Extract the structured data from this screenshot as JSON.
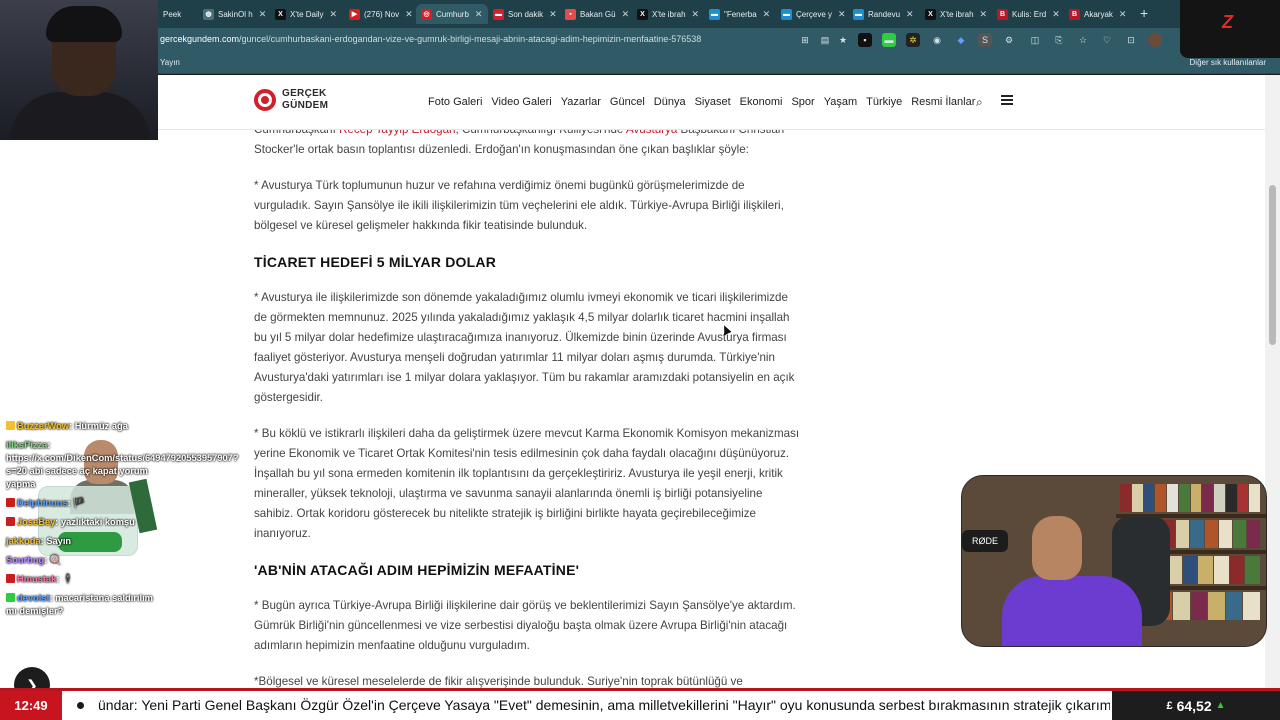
{
  "browser": {
    "tabs": [
      {
        "label": "Peek",
        "fav_color": "#2f5a66"
      },
      {
        "label": "SakinOl h",
        "fav_color": "#4a6f79"
      },
      {
        "label": "X'te Daily",
        "fav_color": "#111111"
      },
      {
        "label": "(276) Nov",
        "fav_color": "#d62020"
      },
      {
        "label": "Cumhurb",
        "fav_color": "#d11f2c"
      },
      {
        "label": "Son dakik",
        "fav_color": "#d11f2c"
      },
      {
        "label": "Bakan Gü",
        "fav_color": "#e44b4b"
      },
      {
        "label": "X'te ibrah",
        "fav_color": "#111111"
      },
      {
        "label": "\"Fenerba",
        "fav_color": "#1d8fd1"
      },
      {
        "label": "Çerçeve y",
        "fav_color": "#1d8fd1"
      },
      {
        "label": "Randevu",
        "fav_color": "#1d8fd1"
      },
      {
        "label": "X'te ibrah",
        "fav_color": "#111111"
      },
      {
        "label": "Kulis: Erd",
        "fav_color": "#b5182a"
      },
      {
        "label": "Akaryak",
        "fav_color": "#b5182a"
      }
    ],
    "new_tab_label": "+",
    "url_host": "gercekgundem.com",
    "url_path": "/guncel/cumhurbaskani-erdogandan-vize-ve-gumruk-birligi-mesaji-abnin-atacagi-adim-hepimizin-menfaatine-576538",
    "bookmark_yayin": "Yayın",
    "bookmark_other": "Diğer sık kullanılanlar"
  },
  "site": {
    "logo_line1": "GERÇEK",
    "logo_line2": "GÜNDEM",
    "brand_color": "#d11f2c",
    "nav": [
      "Foto Galeri",
      "Video Galeri",
      "Yazarlar",
      "Güncel",
      "Dünya",
      "Siyaset",
      "Ekonomi",
      "Spor",
      "Yaşam",
      "Türkiye",
      "Resmi İlanlar"
    ]
  },
  "article": {
    "p0_pre": "Cumhurbaşkanı ",
    "p0_link1": "Recep Tayyip Erdoğan",
    "p0_mid": ", Cumhurbaşkanlığı Külliyesi'nde ",
    "p0_link2": "Avusturya",
    "p0_post": " Başbakanı Christian Stocker'le ortak basın toplantısı düzenledi. Erdoğan'ın konuşmasından öne çıkan başlıklar şöyle:",
    "p1": "* Avusturya Türk toplumunun huzur ve refahına verdiğimiz önemi bugünkü görüşmelerimizde de vurguladık. Sayın Şansölye ile ikili ilişkilerimizin tüm veçhelerini ele aldık. Türkiye-Avrupa Birliği ilişkileri, bölgesel ve küresel gelişmeler hakkında fikir teatisinde bulunduk.",
    "h1": "TİCARET HEDEFİ 5 MİLYAR DOLAR",
    "p2": "* Avusturya ile ilişkilerimizde son dönemde yakaladığımız olumlu ivmeyi ekonomik ve ticari ilişkilerimizde de görmekten memnunuz. 2025 yılında yakaladığımız yaklaşık 4,5 milyar dolarlık ticaret hacmini inşallah bu yıl 5 milyar dolar hedefimize ulaştıracağımıza inanıyoruz. Ülkemizde binin üzerinde Avusturya firması faaliyet gösteriyor. Avusturya menşeli doğrudan yatırımlar 11 milyar doları aşmış durumda. Türkiye'nin Avusturya'daki yatırımları ise 1 milyar dolara yaklaşıyor. Tüm bu rakamlar aramızdaki potansiyelin en açık göstergesidir.",
    "p3": "* Bu köklü ve istikrarlı ilişkileri daha da geliştirmek üzere mevcut Karma Ekonomik Komisyon mekanizması yerine Ekonomik ve Ticaret Ortak Komitesi'nin tesis edilmesinin çok daha faydalı olacağını düşünüyoruz. İnşallah bu yıl sona ermeden komitenin ilk toplantısını da gerçekleştiririz. Avusturya ile yeşil enerji, kritik mineraller, yüksek teknoloji, ulaştırma ve savunma sanayii alanlarında önemli iş birliği potansiyeline sahibiz. Ortak koridoru gösterecek bu nitelikte stratejik iş birliğini birlikte hayata geçirebileceğimize inanıyoruz.",
    "h2": "'AB'NİN ATACAĞI ADIM HEPİMİZİN MEFAATİNE'",
    "p4": "* Bugün ayrıca Türkiye-Avrupa Birliği ilişkilerine dair görüş ve beklentilerimizi Sayın Şansölye'ye aktardım. Gümrük Birliği'nin güncellenmesi ve vize serbestisi diyaloğu başta olmak üzere Avrupa Birliği'nin atacağı adımların hepimizin menfaatine olduğunu vurguladım.",
    "p5": "*Bölgesel ve küresel meselelerde de fikir alışverişinde bulunduk. Suriye'nin toprak bütünlüğü ve"
  },
  "chat": {
    "messages": [
      {
        "user": "BuzzerWow",
        "badge_color": "#f2c12e",
        "user_color": "#f2c12e",
        "text": "Hürmüz ağa"
      },
      {
        "user": "iliksPizza",
        "badge_color": "",
        "user_color": "#7ee07e",
        "text": "https://x.com/DikenCom/status/64947920553957907?s=20 abi sadece aç kapat yorum yapma"
      },
      {
        "user": "Delphinuus",
        "badge_color": "#c81e1e",
        "user_color": "#5aa0ff",
        "text": "🏴"
      },
      {
        "user": "JoseBey",
        "badge_color": "#c81e1e",
        "user_color": "#f2c12e",
        "text": "yazlıktaki komşu"
      },
      {
        "user": "jakkoda",
        "badge_color": "",
        "user_color": "#f2c12e",
        "text": "Sayın"
      },
      {
        "user": "Sourbug",
        "badge_color": "",
        "user_color": "#b88aff",
        "text": "🍭"
      },
      {
        "user": "Hmustak",
        "badge_color": "#c81e1e",
        "user_color": "#ff6fa8",
        "text": "🕴"
      },
      {
        "user": "devoist",
        "badge_color": "#2ecc40",
        "user_color": "#5aa0ff",
        "text": "macaristana saldırılım mı demişler?"
      }
    ]
  },
  "cam_right": {
    "mic_label": "RØDE"
  },
  "overlay_brand": "Z",
  "ticker": {
    "time": "12:49",
    "text": "ündar: Yeni Parti Genel Başkanı Özgür Özel'in Çerçeve Yasaya \"Evet\" demesinin, ama milletvekillerini \"Hayır\" oyu konusunda serbest bırakmasının stratejik çıkarımlarına bakacağız",
    "currency_symbol": "£",
    "price": "64,52",
    "trend": "▲",
    "trend_color": "#2ecc40"
  }
}
